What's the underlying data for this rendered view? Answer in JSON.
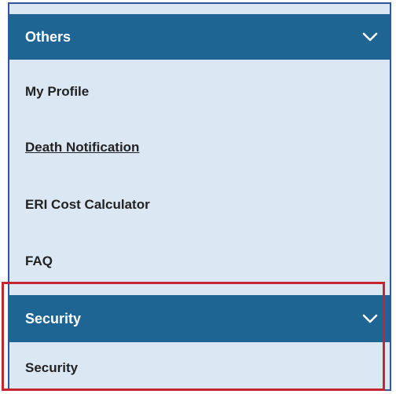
{
  "sections": {
    "others": {
      "title": "Others",
      "items": [
        {
          "label": "My Profile"
        },
        {
          "label": "Death Notification"
        },
        {
          "label": "ERI Cost Calculator"
        },
        {
          "label": "FAQ"
        }
      ]
    },
    "security": {
      "title": "Security",
      "items": [
        {
          "label": "Security"
        }
      ]
    }
  },
  "icons": {
    "expand": "chevron-down-icon"
  },
  "colors": {
    "header_bg": "#1f6593",
    "panel_bg": "#dbe7f3",
    "panel_border": "#2f56a0",
    "highlight_border": "#c62430"
  }
}
